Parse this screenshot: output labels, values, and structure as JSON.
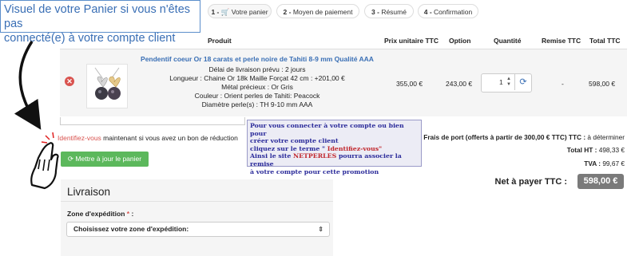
{
  "banner": {
    "line1": "Visuel de votre Panier si vous n'êtes pas",
    "line2": "connecté(e) à votre compte client"
  },
  "steps": [
    {
      "num": "1 -",
      "label": "Votre panier",
      "active": true
    },
    {
      "num": "2 -",
      "label": "Moyen de paiement"
    },
    {
      "num": "3 -",
      "label": "Résumé"
    },
    {
      "num": "4 -",
      "label": "Confirmation"
    }
  ],
  "table": {
    "headers": {
      "produit": "Produit",
      "prix": "Prix unitaire TTC",
      "option": "Option",
      "quantite": "Quantité",
      "remise": "Remise TTC",
      "total": "Total TTC"
    }
  },
  "product": {
    "title": "Pendentif coeur Or 18 carats et perle noire de Tahiti 8-9 mm Qualité AAA",
    "details": [
      "Délai de livraison prévu : 2 jours",
      "Longueur : Chaine Or 18k Maille Forçat 42 cm : +201,00 €",
      "Métal précieux : Or Gris",
      "Couleur : Orient perles de Tahiti: Peacock",
      "Diamètre perle(s) : TH 9-10 mm AAA"
    ],
    "unit_price": "355,00 €",
    "option": "243,00 €",
    "quantity": "1",
    "remise": "-",
    "total": "598,00 €"
  },
  "identify": {
    "link": "Identifiez-vous",
    "rest": " maintenant si vous avez un bon de réduction"
  },
  "popup": {
    "l1": "Pour vous connecter à votre compte ou bien pour",
    "l2": "créer votre compte client",
    "l3a": "cliquez sur le terme \"",
    "l3b": " Identifiez-vous\"",
    "l4a": "Ainsi le site ",
    "l4b": "NETPERLES",
    "l4c": " pourra associer la remise",
    "l5": "à votre compte pour cette promotion"
  },
  "summary": {
    "shipping_label": "Frais de port (offerts à partir de 300,00 € TTC) TTC :",
    "shipping_value": "à déterminer",
    "total_ht_label": "Total HT :",
    "total_ht_value": "498,33 €",
    "tva_label": "TVA :",
    "tva_value": "99,67 €",
    "net_label": "Net à payer TTC :",
    "net_value": "598,00 €"
  },
  "update_button": "Mettre à jour le panier",
  "livraison": {
    "title": "Livraison",
    "zone_label": "Zone d'expédition",
    "zone_required": "*",
    "zone_colon": " :",
    "zone_placeholder": "Choisissez votre zone d'expédition:"
  },
  "colors": {
    "accent": "#3a6fb5",
    "danger": "#d9534f",
    "success": "#5cb85c"
  }
}
